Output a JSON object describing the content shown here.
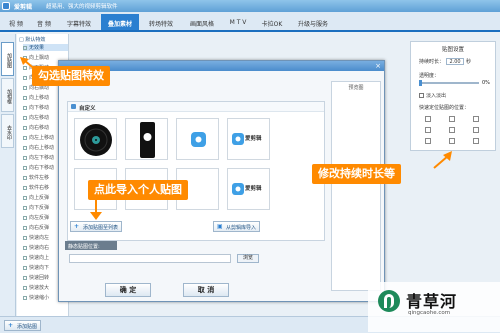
{
  "app": {
    "name": "爱剪辑",
    "slogan": "超易用、强大的视频剪辑软件"
  },
  "menu": {
    "tabs": [
      {
        "label": "视 频"
      },
      {
        "label": "音 频"
      },
      {
        "label": "字幕特效"
      },
      {
        "label": "叠加素材"
      },
      {
        "label": "转场特效"
      },
      {
        "label": "画面风格"
      },
      {
        "label": "M T V"
      },
      {
        "label": "卡拉OK"
      },
      {
        "label": "升级与服务"
      }
    ],
    "active_tab": "叠加素材"
  },
  "sidebar": {
    "tabs": [
      {
        "label": "加贴图"
      },
      {
        "label": "加相框"
      },
      {
        "label": "去水印"
      }
    ]
  },
  "effect_list": {
    "group": "□ 默认特效",
    "items": [
      "无效果",
      "向上飘动",
      "向下飘动",
      "向左飘动",
      "向右飘动",
      "向上移动",
      "向下移动",
      "向左移动",
      "向右移动",
      "向左上移动",
      "向右上移动",
      "向左下移动",
      "向右下移动",
      "软件左移",
      "软件右移",
      "向上反弹",
      "向下反弹",
      "向左反弹",
      "向右反弹",
      "快速向左",
      "快速向右",
      "快速向上",
      "快速向下",
      "快速回转",
      "快速放大",
      "快速缩小"
    ]
  },
  "dialog": {
    "close": "×",
    "custom_panel_title": "自定义",
    "add_to_list": "添加贴图至列表",
    "from_library": "从剪辑库导入",
    "import_label": "静态贴图位置:",
    "browse": "浏览",
    "ok": "确  定",
    "cancel": "取  消",
    "preview_label": "预览图",
    "thumbs": [
      "爱剪辑",
      "爱剪辑"
    ]
  },
  "settings": {
    "title": "贴图设置",
    "duration_label": "持续时长：",
    "duration_value": "2.00",
    "duration_unit": "秒",
    "opacity_label": "透明度：",
    "opacity_value": "0%",
    "fade_label": "淡入淡出",
    "position_label": "快速定位贴图的位置："
  },
  "callouts": {
    "select_effect": "勾选贴图特效",
    "import_sticker": "点此导入个人贴图",
    "edit_duration": "修改持续时长等"
  },
  "footer": {
    "add_sticker": "添加贴图"
  },
  "watermark": {
    "name": "青草河",
    "url": "qingcaohe.com"
  },
  "colors": {
    "accent": "#2b7fd0",
    "callout": "#ff8a00",
    "brand_green": "#1e8a5a"
  }
}
